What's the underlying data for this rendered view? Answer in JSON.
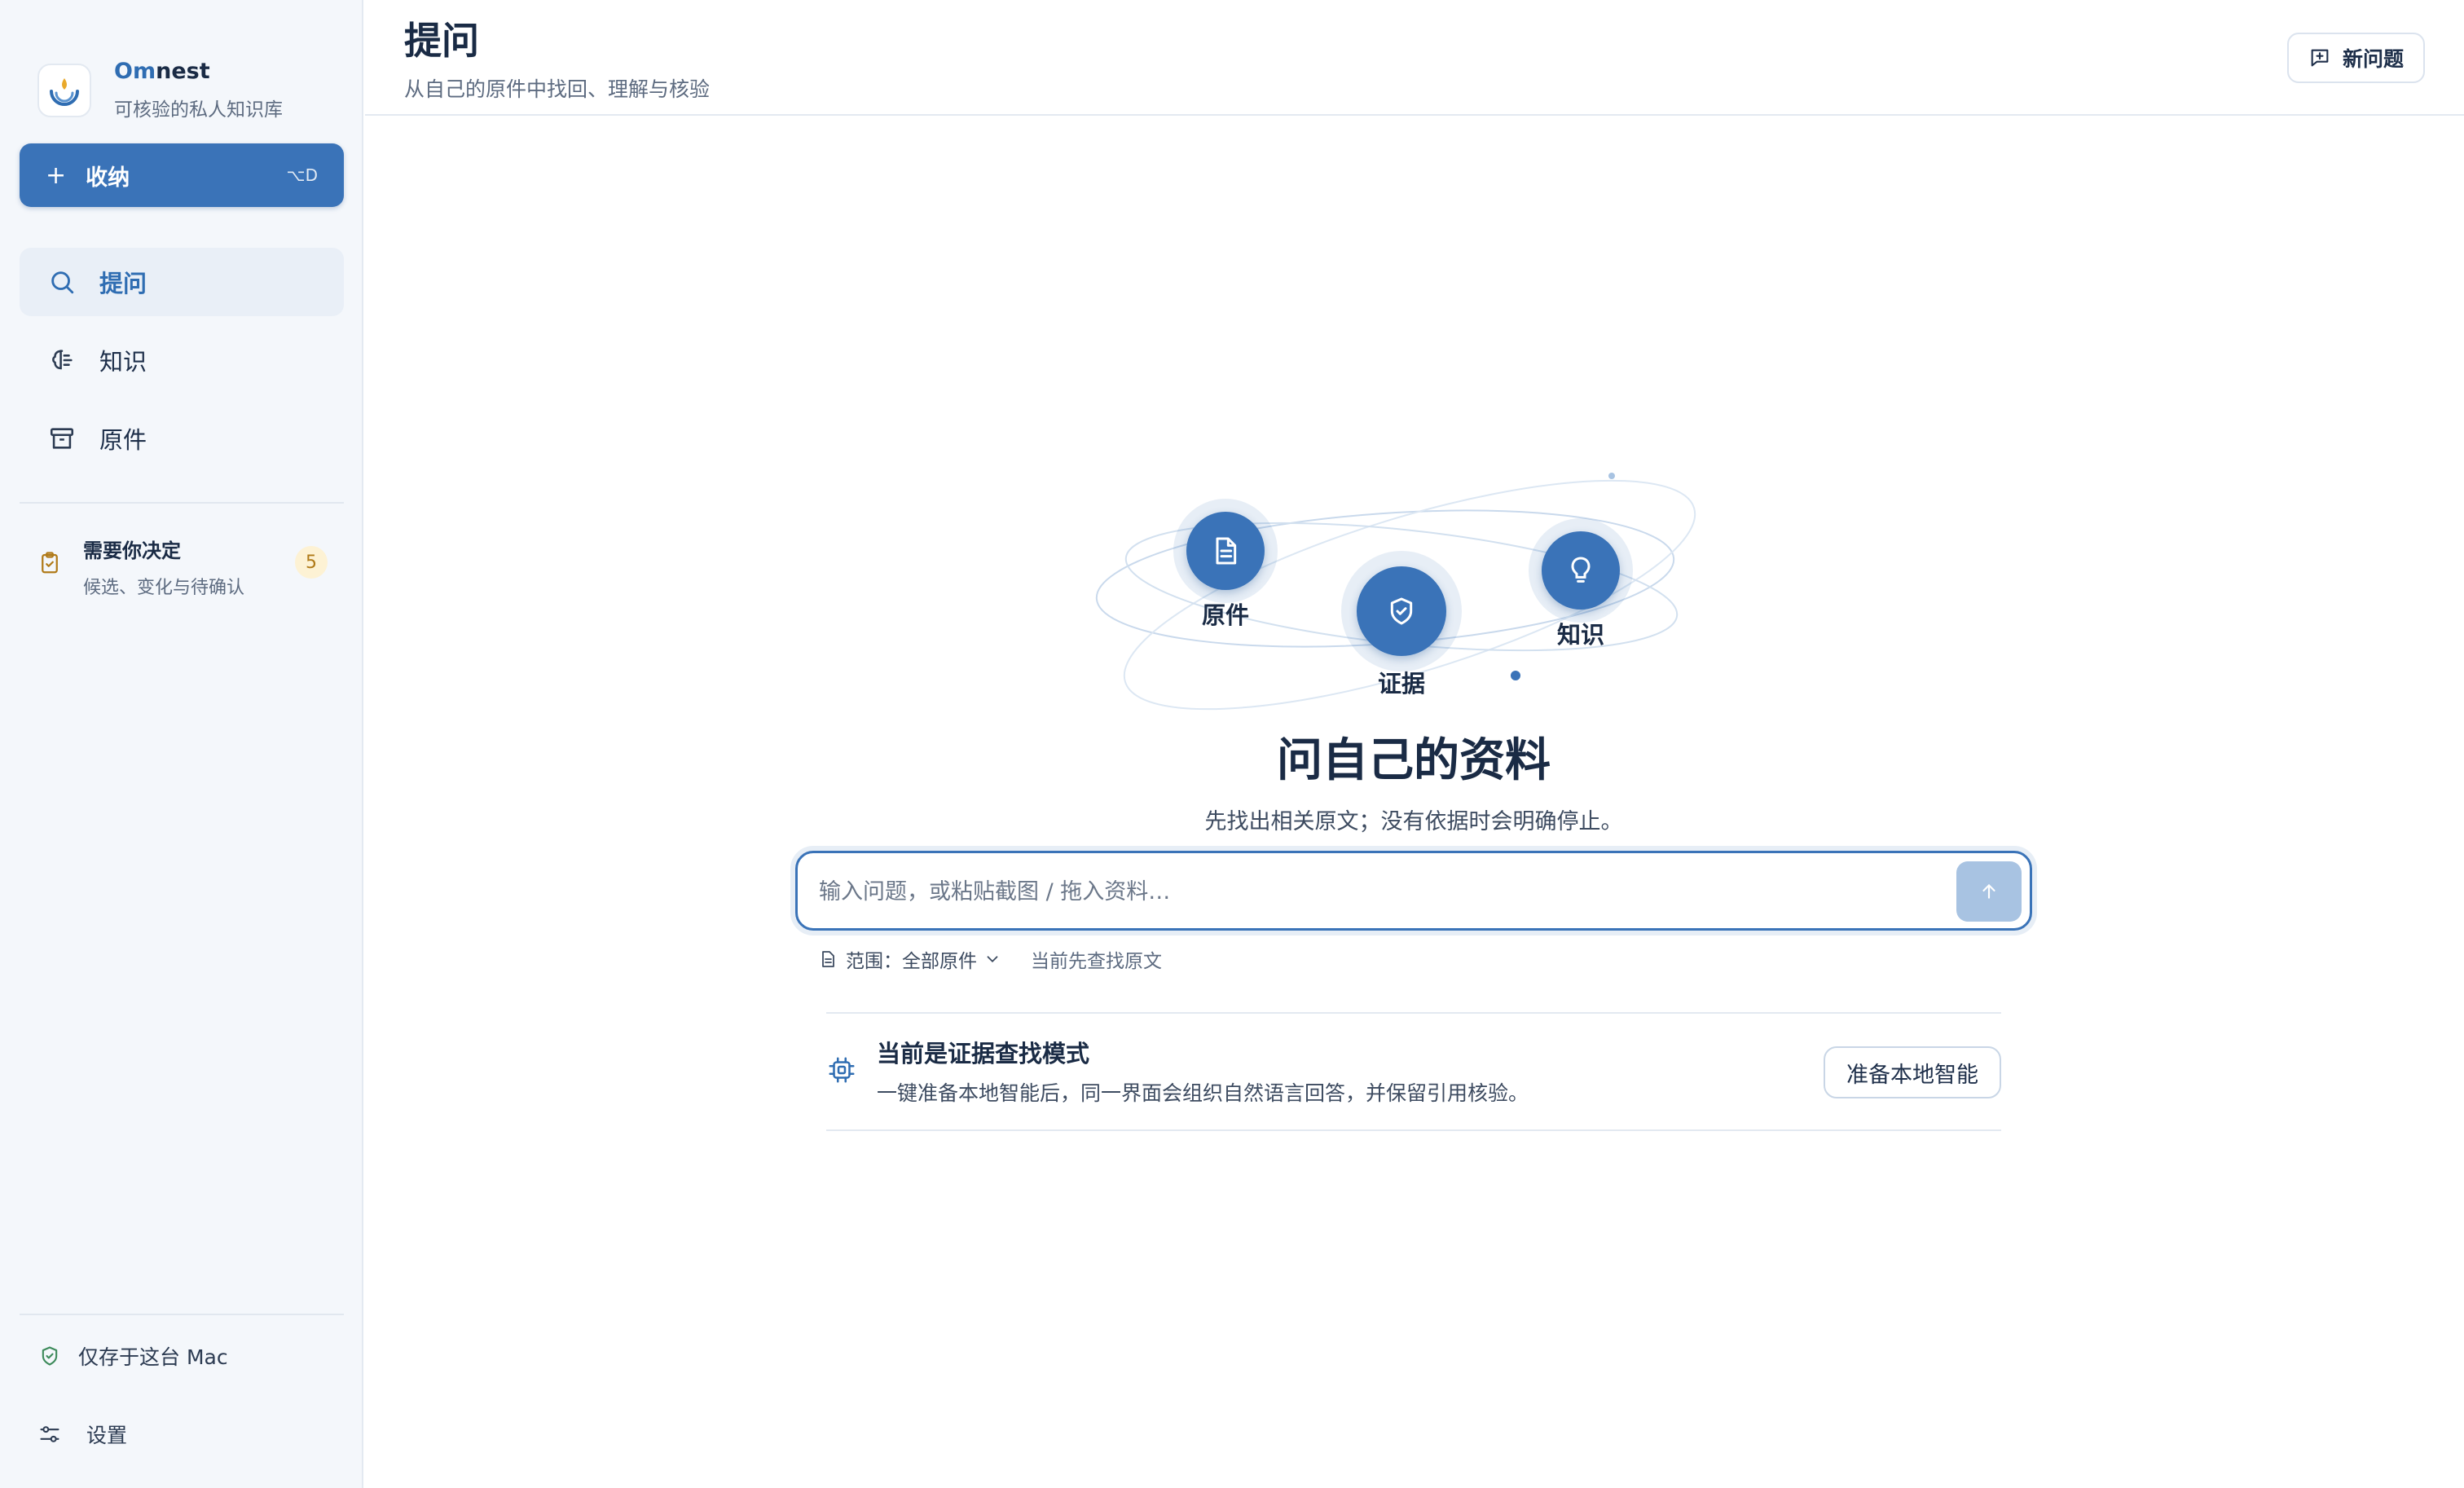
{
  "sidebar": {
    "brand": {
      "name_accent": "Om",
      "name_rest": "nest",
      "subtitle": "可核验的私人知识库"
    },
    "collect": {
      "label": "收纳",
      "shortcut": "⌥D"
    },
    "nav": [
      {
        "label": "提问",
        "icon": "search-icon"
      },
      {
        "label": "知识",
        "icon": "brain-icon"
      },
      {
        "label": "原件",
        "icon": "archive-icon"
      }
    ],
    "decide": {
      "title": "需要你决定",
      "subtitle": "候选、变化与待确认",
      "count": "5"
    },
    "footer": {
      "local_only": "仅存于这台 Mac",
      "settings": "设置"
    }
  },
  "header": {
    "title": "提问",
    "subtitle": "从自己的原件中找回、理解与核验",
    "new_question": "新问题"
  },
  "hero": {
    "nodes": {
      "source": "原件",
      "evidence": "证据",
      "knowledge": "知识"
    },
    "title": "问自己的资料",
    "subtitle": "先找出相关原文；没有依据时会明确停止。"
  },
  "ask": {
    "placeholder": "输入问题，或粘贴截图 / 拖入资料…"
  },
  "scope": {
    "label": "范围：全部原件",
    "note": "当前先查找原文"
  },
  "mode": {
    "title": "当前是证据查找模式",
    "description": "一键准备本地智能后，同一界面会组织自然语言回答，并保留引用核验。",
    "button": "准备本地智能"
  },
  "colors": {
    "accent": "#3a73b8",
    "sidebar_bg": "#f4f7fb",
    "badge_bg": "#fdf2d4"
  }
}
